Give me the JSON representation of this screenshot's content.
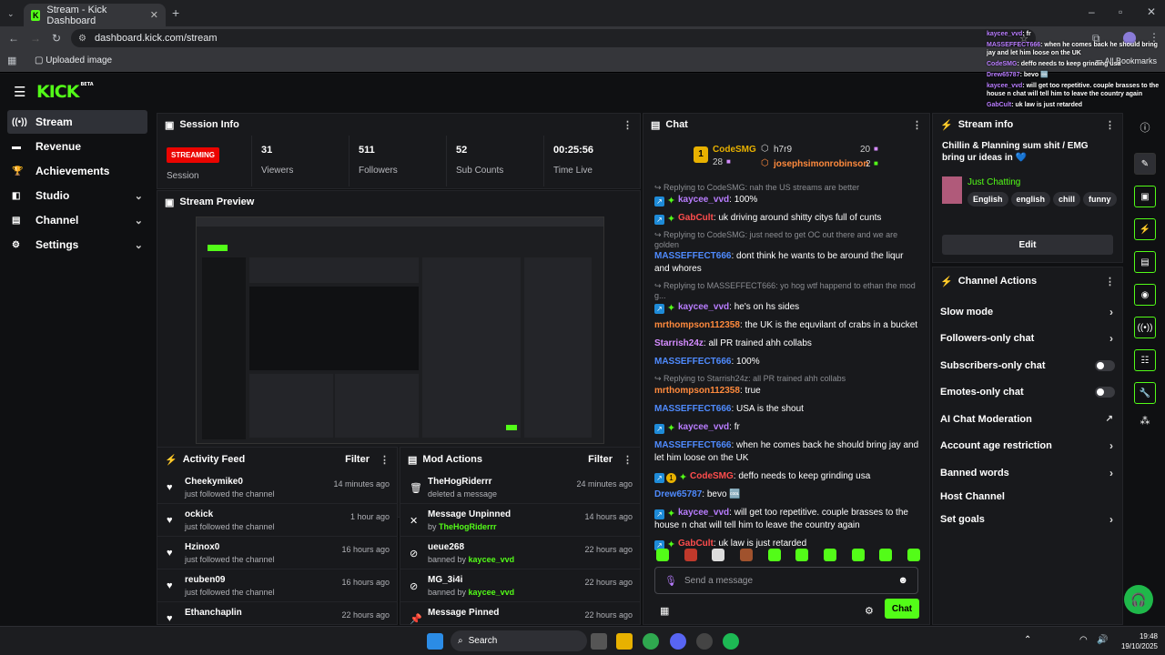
{
  "browser": {
    "tab_title": "Stream - Kick Dashboard",
    "url": "dashboard.kick.com/stream",
    "bookmark": "Uploaded image",
    "all_bookmarks": "All Bookmarks"
  },
  "brand": {
    "logo": "KICK",
    "beta": "BETA",
    "accent": "#53fc18",
    "live_color": "#eb0400"
  },
  "sidebar": {
    "items": [
      {
        "label": "Stream",
        "icon": "broadcast-icon"
      },
      {
        "label": "Revenue",
        "icon": "wallet-icon"
      },
      {
        "label": "Achievements",
        "icon": "trophy-icon"
      },
      {
        "label": "Studio",
        "icon": "studio-icon"
      },
      {
        "label": "Channel",
        "icon": "channel-icon"
      },
      {
        "label": "Settings",
        "icon": "gear-icon"
      }
    ]
  },
  "session": {
    "title": "Session Info",
    "status": "STREAMING",
    "status_label": "Session",
    "stats": [
      {
        "value": "31",
        "label": "Viewers"
      },
      {
        "value": "511",
        "label": "Followers"
      },
      {
        "value": "52",
        "label": "Sub Counts"
      },
      {
        "value": "00:25:56",
        "label": "Time Live"
      }
    ]
  },
  "preview": {
    "title": "Stream Preview"
  },
  "activity": {
    "title": "Activity Feed",
    "filter": "Filter",
    "items": [
      {
        "user": "Cheekymike0",
        "text": "just followed the channel",
        "time": "14 minutes ago"
      },
      {
        "user": "ockick",
        "text": "just followed the channel",
        "time": "1 hour ago"
      },
      {
        "user": "Hzinox0",
        "text": "just followed the channel",
        "time": "16 hours ago"
      },
      {
        "user": "reuben09",
        "text": "just followed the channel",
        "time": "16 hours ago"
      },
      {
        "user": "Ethanchaplin",
        "text": "",
        "time": "22 hours ago"
      }
    ]
  },
  "mod": {
    "title": "Mod Actions",
    "filter": "Filter",
    "items": [
      {
        "user": "TheHogRiderrr",
        "pre": "deleted a message",
        "by": "",
        "time": "24 minutes ago"
      },
      {
        "user": "Message Unpinned",
        "pre": "by ",
        "by": "TheHogRiderrr",
        "time": "14 hours ago"
      },
      {
        "user": "ueue268",
        "pre": "banned by ",
        "by": "kaycee_vvd",
        "time": "22 hours ago"
      },
      {
        "user": "MG_3i4i",
        "pre": "banned by ",
        "by": "kaycee_vvd",
        "time": "22 hours ago"
      },
      {
        "user": "Message Pinned",
        "pre": "",
        "by": "",
        "time": "22 hours ago"
      }
    ]
  },
  "chat": {
    "title": "Chat",
    "top": {
      "first": "CodeSMG",
      "first_count": "28",
      "second": "h7r9",
      "second_count": "20",
      "third": "josephsimonrobinson",
      "third_count": "2"
    },
    "messages": [
      {
        "reply": "Replying to CodeSMG: nah the US streams are better",
        "user": "kaycee_vvd",
        "color": "#b97dff",
        "badges": [
          "b1",
          "b2"
        ],
        "text": "100%"
      },
      {
        "reply": "",
        "user": "GabCult",
        "color": "#ff4d4d",
        "badges": [
          "b1",
          "b2"
        ],
        "text": "uk driving around shitty citys full of cunts"
      },
      {
        "reply": "Replying to CodeSMG: just need to get OC out there and we are golden",
        "user": "MASSEFFECT666",
        "color": "#4f8bff",
        "badges": [],
        "text": "dont think he wants to be around the liqur and whores"
      },
      {
        "reply": "Replying to MASSEFFECT666: yo hog wtf happend to ethan the mod g...",
        "user": "kaycee_vvd",
        "color": "#b97dff",
        "badges": [
          "b1",
          "b2"
        ],
        "text": "he's on hs sides"
      },
      {
        "reply": "",
        "user": "mrthompson112358",
        "color": "#ff8a3d",
        "badges": [],
        "text": "the UK is the equvilant of crabs in a bucket"
      },
      {
        "reply": "",
        "user": "Starrish24z",
        "color": "#d58cff",
        "badges": [],
        "text": "all PR trained ahh collabs"
      },
      {
        "reply": "",
        "user": "MASSEFFECT666",
        "color": "#4f8bff",
        "badges": [],
        "text": "100%"
      },
      {
        "reply": "Replying to Starrish24z: all PR trained ahh collabs",
        "user": "mrthompson112358",
        "color": "#ff8a3d",
        "badges": [],
        "text": "true"
      },
      {
        "reply": "",
        "user": "MASSEFFECT666",
        "color": "#4f8bff",
        "badges": [],
        "text": "USA is the shout"
      },
      {
        "reply": "",
        "user": "kaycee_vvd",
        "color": "#b97dff",
        "badges": [
          "b1",
          "b2"
        ],
        "text": "fr"
      },
      {
        "reply": "",
        "user": "MASSEFFECT666",
        "color": "#4f8bff",
        "badges": [],
        "text": "when he comes back he should bring jay and let him loose on the UK"
      },
      {
        "reply": "",
        "user": "CodeSMG",
        "color": "#ff4d4d",
        "badges": [
          "b1",
          "b3",
          "b2"
        ],
        "text": "deffo needs to keep grinding usa"
      },
      {
        "reply": "",
        "user": "Drew65787",
        "color": "#4f8bff",
        "badges": [],
        "text": "bevo 🆒"
      },
      {
        "reply": "",
        "user": "kaycee_vvd",
        "color": "#b97dff",
        "badges": [
          "b1",
          "b2"
        ],
        "text": "will get too repetitive. couple brasses to the house n chat will tell him to leave the country again"
      },
      {
        "reply": "",
        "user": "GabCult",
        "color": "#ff4d4d",
        "badges": [
          "b1",
          "b2"
        ],
        "text": "uk law is just retarded"
      }
    ],
    "placeholder": "Send a message",
    "send": "Chat"
  },
  "streaminfo": {
    "title": "Stream info",
    "stream_title": "Chillin & Planning sum shit / EMG bring ur ideas in 💙",
    "category": "Just Chatting",
    "tags": [
      "English",
      "english",
      "chill",
      "funny"
    ],
    "edit": "Edit"
  },
  "actions": {
    "title": "Channel Actions",
    "items": [
      {
        "label": "Slow mode",
        "ctl": "chevron"
      },
      {
        "label": "Followers-only chat",
        "ctl": "chevron"
      },
      {
        "label": "Subscribers-only chat",
        "ctl": "toggle"
      },
      {
        "label": "Emotes-only chat",
        "ctl": "toggle"
      },
      {
        "label": "AI Chat Moderation",
        "ctl": "external"
      },
      {
        "label": "Account age restriction",
        "ctl": "chevron"
      },
      {
        "label": "Banned words",
        "ctl": "chevron"
      },
      {
        "label": "Host Channel",
        "ctl": "none"
      },
      {
        "label": "Set goals",
        "ctl": "chevron"
      }
    ]
  },
  "overlay": {
    "lines": [
      {
        "user": "kaycee_vvd",
        "text": "fr"
      },
      {
        "user": "MASSEFFECT666",
        "text": "when he comes back he should bring jay and let him loose on the UK"
      },
      {
        "user": "CodeSMG",
        "text": "deffo needs to keep grinding usa"
      },
      {
        "user": "Drew65787",
        "text": "bevo 🆒"
      },
      {
        "user": "kaycee_vvd",
        "text": "will get too repetitive. couple brasses to the house n chat will tell him to leave the country again"
      },
      {
        "user": "GabCult",
        "text": "uk law is just retarded"
      }
    ]
  },
  "taskbar": {
    "search": "Search",
    "time": "19:48",
    "date": "19/10/2025"
  }
}
